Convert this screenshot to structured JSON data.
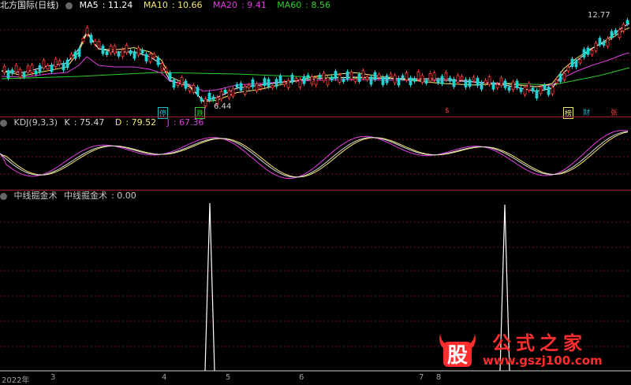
{
  "main_pane": {
    "title": "北方国际(日线)",
    "ma_labels": [
      {
        "name": "MA5",
        "value": "11.24",
        "color": "#ffffff"
      },
      {
        "name": "MA10",
        "value": "10.66",
        "color": "#f3e96b"
      },
      {
        "name": "MA20",
        "value": "9.41",
        "color": "#e03ce0"
      },
      {
        "name": "MA60",
        "value": "8.56",
        "color": "#2bd12b"
      }
    ],
    "high_label": "12.77",
    "low_label": "6.44",
    "event_tags": [
      {
        "text": "停",
        "color": "#26b5c7"
      },
      {
        "text": "跌",
        "color": "#2bd12b"
      },
      {
        "text": "$",
        "color": "#ff4040"
      },
      {
        "text": "榜",
        "color": "#f3e96b"
      },
      {
        "text": "财",
        "color": "#26b5c7"
      },
      {
        "text": "张",
        "color": "#ff4040"
      }
    ]
  },
  "kdj_pane": {
    "title": "KDJ(9,3,3)",
    "values": [
      {
        "name": "K",
        "value": "75.47",
        "color": "#d9d9d9"
      },
      {
        "name": "D",
        "value": "79.52",
        "color": "#f3e96b"
      },
      {
        "name": "J",
        "value": "67.36",
        "color": "#e03ce0"
      }
    ]
  },
  "signal_pane": {
    "title": "中线掘金术",
    "series_label": "中线掘金术",
    "value": "0.00"
  },
  "date_axis": [
    "2022年",
    "3",
    "4",
    "5",
    "6",
    "7",
    "8"
  ],
  "watermark": {
    "logo_char": "股",
    "title": "公式之家",
    "url": "www.gszj100.com"
  },
  "colors": {
    "up": "#ff3b3b",
    "down": "#22d3d3",
    "separator": "#9b1b30",
    "grid": "#7a1020"
  }
}
